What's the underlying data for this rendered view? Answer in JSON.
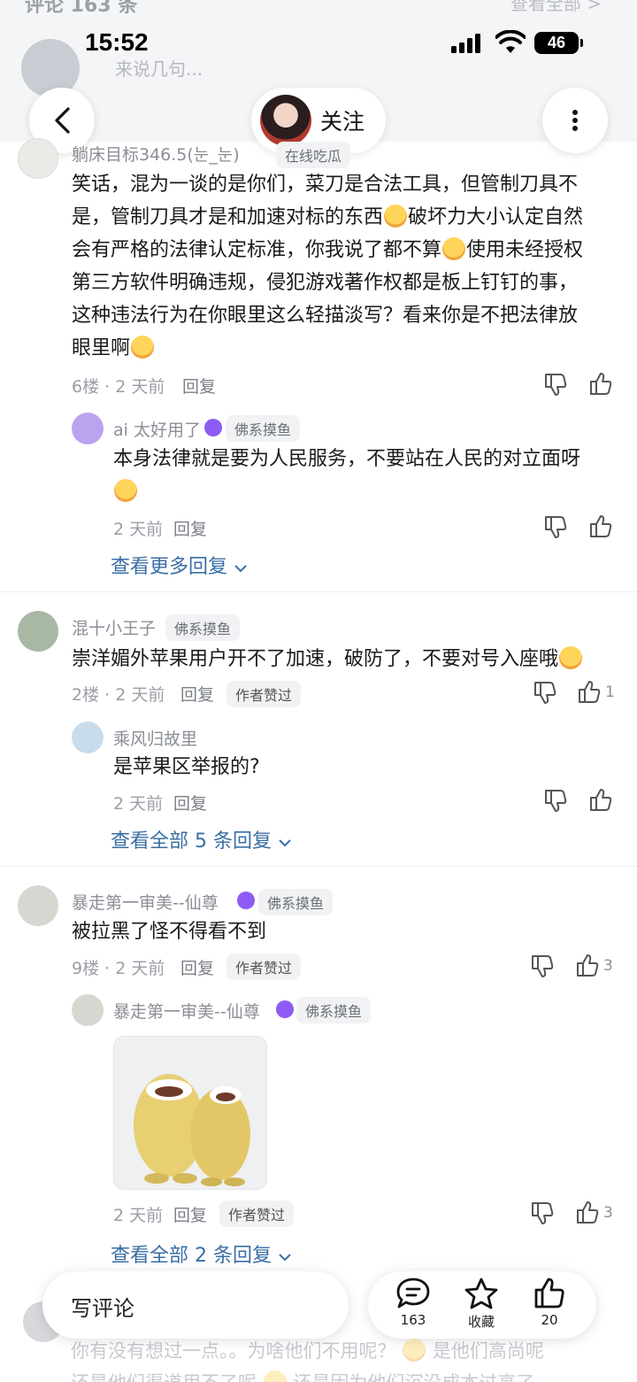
{
  "ghost_header": {
    "title": "评论 163 条",
    "view_all": "查看全部 >",
    "input_placeholder": "来说几句..."
  },
  "status_bar": {
    "time": "15:52",
    "battery": "46"
  },
  "nav": {
    "follow_label": "关注"
  },
  "comments": [
    {
      "username": "躺床目标346.5(눈_눈)",
      "tag": "在线吃瓜",
      "text_lines": [
        "笑话，混为一谈的是你们，菜刀是合法工具，但管制刀具不",
        "是，管制刀具才是和加速对标的东西",
        "破坏力大小认定自然",
        "会有严格的法律认定标准，你我说了都不算",
        "使用未经授权",
        "第三方软件明确违规，侵犯游戏著作权都是板上钉钉的事，",
        "这种违法行为在你眼里这么轻描淡写？看来你是不把法律放",
        "眼里啊"
      ],
      "meta": "6楼 · 2 天前",
      "reply": "回复",
      "replies": [
        {
          "username": "ai 太好用了",
          "tag": "佛系摸鱼",
          "text_lines": [
            "本身法律就是要为人民服务，不要站在人民的对立面呀"
          ],
          "meta": "2 天前",
          "reply": "回复"
        }
      ],
      "view_more": "查看更多回复"
    },
    {
      "username": "混十小王子",
      "tag": "佛系摸鱼",
      "text_lines": [
        "崇洋媚外苹果用户开不了加速，破防了，不要对号入座哦"
      ],
      "meta": "2楼 · 2 天前",
      "reply": "回复",
      "author_liked": "作者赞过",
      "likes": "1",
      "replies": [
        {
          "username": "乘风归故里",
          "text_lines": [
            "是苹果区举报的?"
          ],
          "meta": "2 天前",
          "reply": "回复"
        }
      ],
      "view_more": "查看全部 5 条回复"
    },
    {
      "username": "暴走第一审美--仙尊",
      "tag": "佛系摸鱼",
      "text_lines": [
        "被拉黑了怪不得看不到"
      ],
      "meta": "9楼 · 2 天前",
      "reply": "回复",
      "author_liked": "作者赞过",
      "likes": "3",
      "replies": [
        {
          "username": "暴走第一审美--仙尊",
          "tag": "佛系摸鱼",
          "meta": "2 天前",
          "reply": "回复",
          "author_liked": "作者赞过",
          "likes": "3"
        }
      ],
      "view_more": "查看全部 2 条回复"
    }
  ],
  "bottom_ghost": {
    "line1": "你有没有想过一点。。为啥他们不用呢？",
    "line1b": "是他们高尚呢",
    "line2": "还是他们渠道用不了呢",
    "line2b": "还是因为他们沉没成本过高了"
  },
  "bottom_bar": {
    "write_label": "写评论",
    "comment_count": "163",
    "favorite_label": "收藏",
    "like_count": "20"
  },
  "colors": {
    "link": "#3a6ea5",
    "muted": "#9a9ea6",
    "badge_bg": "#f1f2f4",
    "level_icon": "#8d5cf6"
  }
}
